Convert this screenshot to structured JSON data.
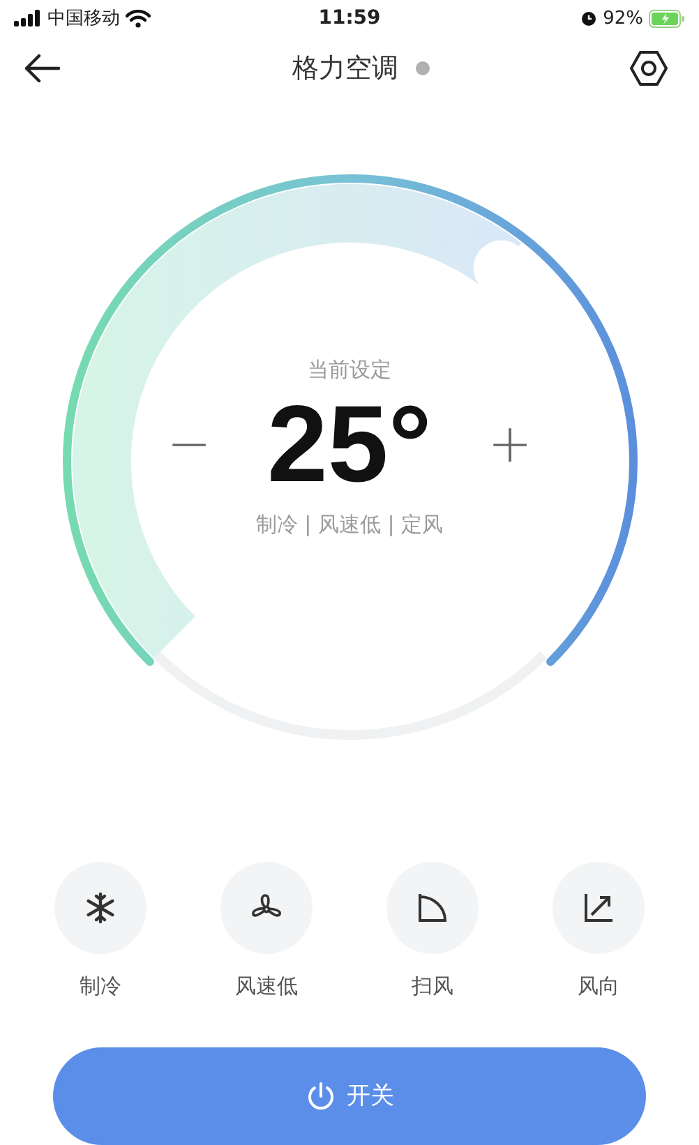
{
  "status_bar": {
    "carrier": "中国移动",
    "time": "11:59",
    "battery": "92%"
  },
  "header": {
    "title": "格力空调",
    "online": false
  },
  "dial": {
    "caption": "当前设定",
    "minus": "−",
    "temperature": "25°",
    "plus": "+",
    "summary": "制冷 | 风速低 | 定风"
  },
  "modes": [
    {
      "kind": "cool",
      "label": "制冷"
    },
    {
      "kind": "fan",
      "label": "风速低"
    },
    {
      "kind": "sweep",
      "label": "扫风"
    },
    {
      "kind": "direction",
      "label": "风向"
    }
  ],
  "power_button": {
    "label": "开关"
  }
}
